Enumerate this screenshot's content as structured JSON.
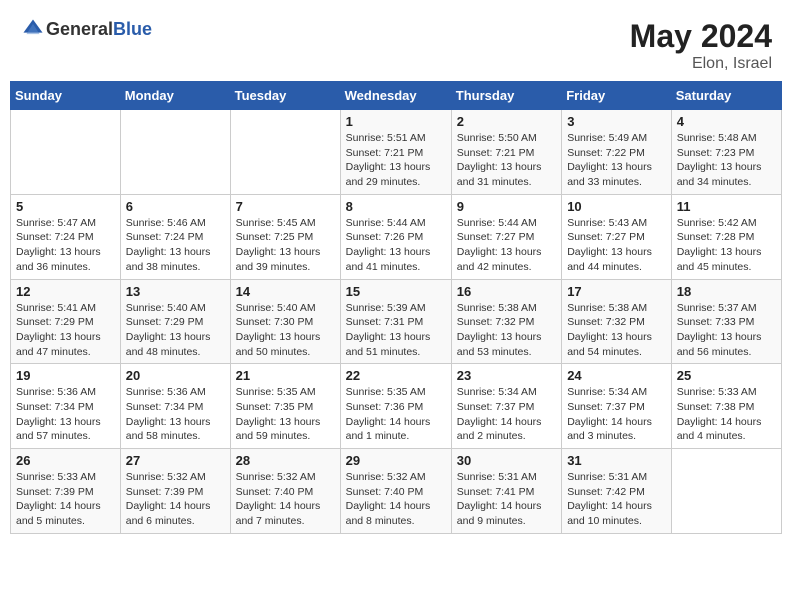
{
  "header": {
    "logo_general": "General",
    "logo_blue": "Blue",
    "month": "May 2024",
    "location": "Elon, Israel"
  },
  "columns": [
    "Sunday",
    "Monday",
    "Tuesday",
    "Wednesday",
    "Thursday",
    "Friday",
    "Saturday"
  ],
  "weeks": [
    [
      {
        "day": "",
        "info": ""
      },
      {
        "day": "",
        "info": ""
      },
      {
        "day": "",
        "info": ""
      },
      {
        "day": "1",
        "info": "Sunrise: 5:51 AM\nSunset: 7:21 PM\nDaylight: 13 hours\nand 29 minutes."
      },
      {
        "day": "2",
        "info": "Sunrise: 5:50 AM\nSunset: 7:21 PM\nDaylight: 13 hours\nand 31 minutes."
      },
      {
        "day": "3",
        "info": "Sunrise: 5:49 AM\nSunset: 7:22 PM\nDaylight: 13 hours\nand 33 minutes."
      },
      {
        "day": "4",
        "info": "Sunrise: 5:48 AM\nSunset: 7:23 PM\nDaylight: 13 hours\nand 34 minutes."
      }
    ],
    [
      {
        "day": "5",
        "info": "Sunrise: 5:47 AM\nSunset: 7:24 PM\nDaylight: 13 hours\nand 36 minutes."
      },
      {
        "day": "6",
        "info": "Sunrise: 5:46 AM\nSunset: 7:24 PM\nDaylight: 13 hours\nand 38 minutes."
      },
      {
        "day": "7",
        "info": "Sunrise: 5:45 AM\nSunset: 7:25 PM\nDaylight: 13 hours\nand 39 minutes."
      },
      {
        "day": "8",
        "info": "Sunrise: 5:44 AM\nSunset: 7:26 PM\nDaylight: 13 hours\nand 41 minutes."
      },
      {
        "day": "9",
        "info": "Sunrise: 5:44 AM\nSunset: 7:27 PM\nDaylight: 13 hours\nand 42 minutes."
      },
      {
        "day": "10",
        "info": "Sunrise: 5:43 AM\nSunset: 7:27 PM\nDaylight: 13 hours\nand 44 minutes."
      },
      {
        "day": "11",
        "info": "Sunrise: 5:42 AM\nSunset: 7:28 PM\nDaylight: 13 hours\nand 45 minutes."
      }
    ],
    [
      {
        "day": "12",
        "info": "Sunrise: 5:41 AM\nSunset: 7:29 PM\nDaylight: 13 hours\nand 47 minutes."
      },
      {
        "day": "13",
        "info": "Sunrise: 5:40 AM\nSunset: 7:29 PM\nDaylight: 13 hours\nand 48 minutes."
      },
      {
        "day": "14",
        "info": "Sunrise: 5:40 AM\nSunset: 7:30 PM\nDaylight: 13 hours\nand 50 minutes."
      },
      {
        "day": "15",
        "info": "Sunrise: 5:39 AM\nSunset: 7:31 PM\nDaylight: 13 hours\nand 51 minutes."
      },
      {
        "day": "16",
        "info": "Sunrise: 5:38 AM\nSunset: 7:32 PM\nDaylight: 13 hours\nand 53 minutes."
      },
      {
        "day": "17",
        "info": "Sunrise: 5:38 AM\nSunset: 7:32 PM\nDaylight: 13 hours\nand 54 minutes."
      },
      {
        "day": "18",
        "info": "Sunrise: 5:37 AM\nSunset: 7:33 PM\nDaylight: 13 hours\nand 56 minutes."
      }
    ],
    [
      {
        "day": "19",
        "info": "Sunrise: 5:36 AM\nSunset: 7:34 PM\nDaylight: 13 hours\nand 57 minutes."
      },
      {
        "day": "20",
        "info": "Sunrise: 5:36 AM\nSunset: 7:34 PM\nDaylight: 13 hours\nand 58 minutes."
      },
      {
        "day": "21",
        "info": "Sunrise: 5:35 AM\nSunset: 7:35 PM\nDaylight: 13 hours\nand 59 minutes."
      },
      {
        "day": "22",
        "info": "Sunrise: 5:35 AM\nSunset: 7:36 PM\nDaylight: 14 hours\nand 1 minute."
      },
      {
        "day": "23",
        "info": "Sunrise: 5:34 AM\nSunset: 7:37 PM\nDaylight: 14 hours\nand 2 minutes."
      },
      {
        "day": "24",
        "info": "Sunrise: 5:34 AM\nSunset: 7:37 PM\nDaylight: 14 hours\nand 3 minutes."
      },
      {
        "day": "25",
        "info": "Sunrise: 5:33 AM\nSunset: 7:38 PM\nDaylight: 14 hours\nand 4 minutes."
      }
    ],
    [
      {
        "day": "26",
        "info": "Sunrise: 5:33 AM\nSunset: 7:39 PM\nDaylight: 14 hours\nand 5 minutes."
      },
      {
        "day": "27",
        "info": "Sunrise: 5:32 AM\nSunset: 7:39 PM\nDaylight: 14 hours\nand 6 minutes."
      },
      {
        "day": "28",
        "info": "Sunrise: 5:32 AM\nSunset: 7:40 PM\nDaylight: 14 hours\nand 7 minutes."
      },
      {
        "day": "29",
        "info": "Sunrise: 5:32 AM\nSunset: 7:40 PM\nDaylight: 14 hours\nand 8 minutes."
      },
      {
        "day": "30",
        "info": "Sunrise: 5:31 AM\nSunset: 7:41 PM\nDaylight: 14 hours\nand 9 minutes."
      },
      {
        "day": "31",
        "info": "Sunrise: 5:31 AM\nSunset: 7:42 PM\nDaylight: 14 hours\nand 10 minutes."
      },
      {
        "day": "",
        "info": ""
      }
    ]
  ]
}
